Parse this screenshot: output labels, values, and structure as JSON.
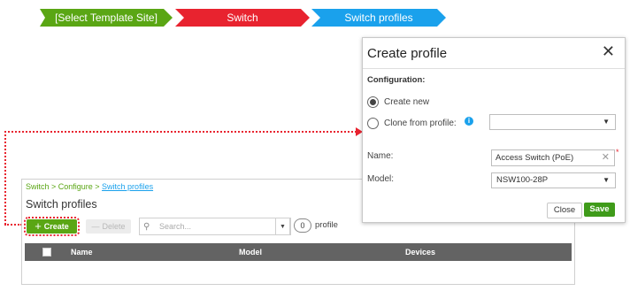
{
  "steps": [
    "[Select Template Site]",
    "Switch",
    "Switch profiles"
  ],
  "colors": {
    "green": "#5aa614",
    "red": "#e8232f",
    "blue": "#1aa1ec",
    "header": "#636363"
  },
  "page": {
    "breadcrumb": {
      "part1": "Switch > Configure > ",
      "link": "Switch profiles"
    },
    "title": "Switch profiles",
    "toolbar": {
      "create_label": "Create",
      "delete_label": "Delete",
      "search_placeholder": "Search...",
      "count": "0",
      "count_label": "profile"
    },
    "table": {
      "columns": [
        "Name",
        "Model",
        "Devices"
      ]
    }
  },
  "modal": {
    "title": "Create profile",
    "config_label": "Configuration:",
    "option_new": "Create new",
    "option_clone": "Clone from profile:",
    "clone_value": "",
    "name_label": "Name:",
    "name_value": "Access Switch (PoE)",
    "model_label": "Model:",
    "model_value": "NSW100-28P",
    "close_label": "Close",
    "save_label": "Save",
    "icons": [
      "close-icon",
      "info-icon",
      "chevron-down-icon",
      "clear-icon"
    ]
  }
}
